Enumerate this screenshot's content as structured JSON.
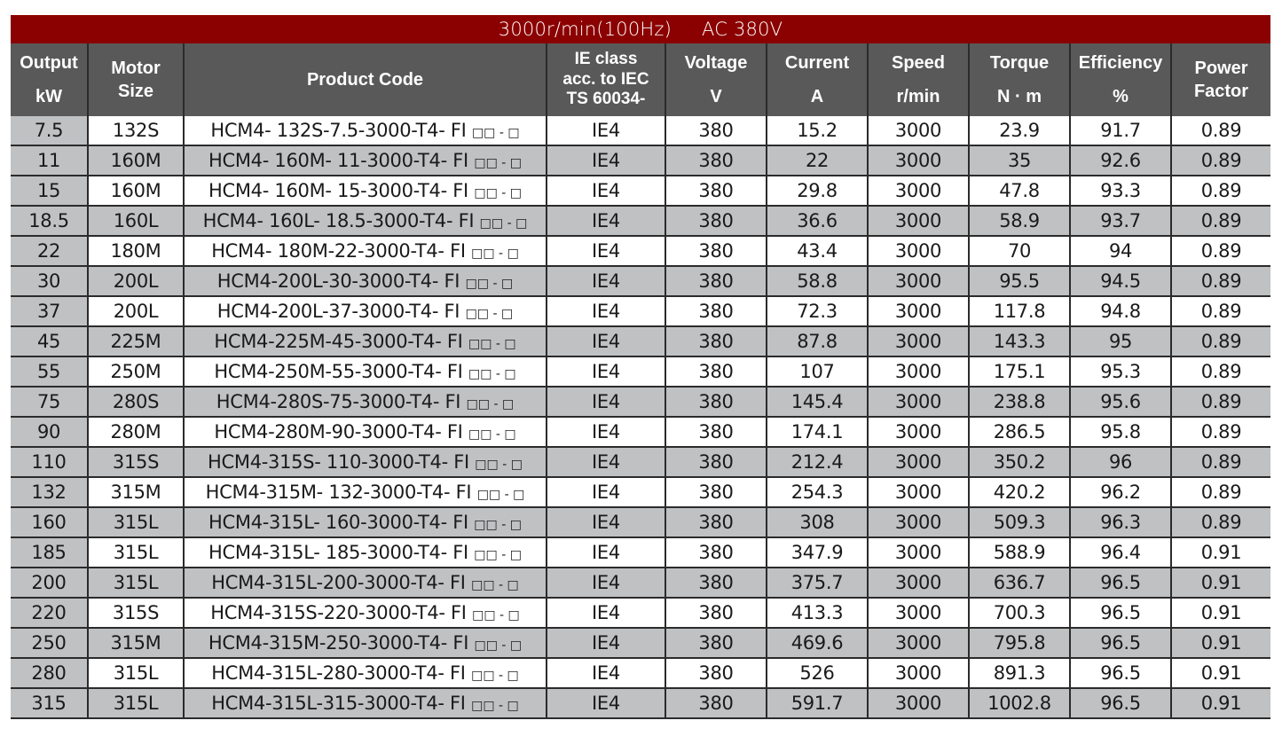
{
  "title": {
    "speed": "3000r/min(100Hz)",
    "voltage": "AC 380V"
  },
  "colors": {
    "title_bar": "#8b0000",
    "header_bg": "#595959",
    "stripe_grey": "#bfc1c3",
    "stripe_white": "#ffffff"
  },
  "headers": [
    {
      "line1": "Output",
      "line2": "kW"
    },
    {
      "line1": "Motor",
      "line2": "Size"
    },
    {
      "line1": "Product Code"
    },
    {
      "line1": "IE class",
      "line2": "acc. to IEC",
      "line3": "TS 60034-"
    },
    {
      "line1": "Voltage",
      "line2": "V"
    },
    {
      "line1": "Current",
      "line2": "A"
    },
    {
      "line1": "Speed",
      "line2": "r/min"
    },
    {
      "line1": "Torque",
      "line2": "N · m"
    },
    {
      "line1": "Efficiency",
      "line2": "%"
    },
    {
      "line1": "Power",
      "line2": "Factor"
    }
  ],
  "code_suffix": "□□ - □",
  "rows": [
    {
      "kw": "7.5",
      "size": "132S",
      "code": "HCM4- 132S-7.5-3000-T4- FI",
      "ie": "IE4",
      "v": "380",
      "a": "15.2",
      "rpm": "3000",
      "nm": "23.9",
      "eff": "91.7",
      "pf": "0.89"
    },
    {
      "kw": "11",
      "size": "160M",
      "code": "HCM4- 160M- 11-3000-T4- FI",
      "ie": "IE4",
      "v": "380",
      "a": "22",
      "rpm": "3000",
      "nm": "35",
      "eff": "92.6",
      "pf": "0.89"
    },
    {
      "kw": "15",
      "size": "160M",
      "code": "HCM4- 160M- 15-3000-T4- FI",
      "ie": "IE4",
      "v": "380",
      "a": "29.8",
      "rpm": "3000",
      "nm": "47.8",
      "eff": "93.3",
      "pf": "0.89"
    },
    {
      "kw": "18.5",
      "size": "160L",
      "code": "HCM4- 160L- 18.5-3000-T4- FI",
      "ie": "IE4",
      "v": "380",
      "a": "36.6",
      "rpm": "3000",
      "nm": "58.9",
      "eff": "93.7",
      "pf": "0.89"
    },
    {
      "kw": "22",
      "size": "180M",
      "code": "HCM4- 180M-22-3000-T4- FI",
      "ie": "IE4",
      "v": "380",
      "a": "43.4",
      "rpm": "3000",
      "nm": "70",
      "eff": "94",
      "pf": "0.89"
    },
    {
      "kw": "30",
      "size": "200L",
      "code": "HCM4-200L-30-3000-T4- FI",
      "ie": "IE4",
      "v": "380",
      "a": "58.8",
      "rpm": "3000",
      "nm": "95.5",
      "eff": "94.5",
      "pf": "0.89"
    },
    {
      "kw": "37",
      "size": "200L",
      "code": "HCM4-200L-37-3000-T4- FI",
      "ie": "IE4",
      "v": "380",
      "a": "72.3",
      "rpm": "3000",
      "nm": "117.8",
      "eff": "94.8",
      "pf": "0.89"
    },
    {
      "kw": "45",
      "size": "225M",
      "code": "HCM4-225M-45-3000-T4- FI",
      "ie": "IE4",
      "v": "380",
      "a": "87.8",
      "rpm": "3000",
      "nm": "143.3",
      "eff": "95",
      "pf": "0.89"
    },
    {
      "kw": "55",
      "size": "250M",
      "code": "HCM4-250M-55-3000-T4- FI",
      "ie": "IE4",
      "v": "380",
      "a": "107",
      "rpm": "3000",
      "nm": "175.1",
      "eff": "95.3",
      "pf": "0.89"
    },
    {
      "kw": "75",
      "size": "280S",
      "code": "HCM4-280S-75-3000-T4- FI",
      "ie": "IE4",
      "v": "380",
      "a": "145.4",
      "rpm": "3000",
      "nm": "238.8",
      "eff": "95.6",
      "pf": "0.89"
    },
    {
      "kw": "90",
      "size": "280M",
      "code": "HCM4-280M-90-3000-T4- FI",
      "ie": "IE4",
      "v": "380",
      "a": "174.1",
      "rpm": "3000",
      "nm": "286.5",
      "eff": "95.8",
      "pf": "0.89"
    },
    {
      "kw": "110",
      "size": "315S",
      "code": "HCM4-315S- 110-3000-T4- FI",
      "ie": "IE4",
      "v": "380",
      "a": "212.4",
      "rpm": "3000",
      "nm": "350.2",
      "eff": "96",
      "pf": "0.89"
    },
    {
      "kw": "132",
      "size": "315M",
      "code": "HCM4-315M- 132-3000-T4- FI",
      "ie": "IE4",
      "v": "380",
      "a": "254.3",
      "rpm": "3000",
      "nm": "420.2",
      "eff": "96.2",
      "pf": "0.89"
    },
    {
      "kw": "160",
      "size": "315L",
      "code": "HCM4-315L- 160-3000-T4- FI",
      "ie": "IE4",
      "v": "380",
      "a": "308",
      "rpm": "3000",
      "nm": "509.3",
      "eff": "96.3",
      "pf": "0.89"
    },
    {
      "kw": "185",
      "size": "315L",
      "code": "HCM4-315L- 185-3000-T4- FI",
      "ie": "IE4",
      "v": "380",
      "a": "347.9",
      "rpm": "3000",
      "nm": "588.9",
      "eff": "96.4",
      "pf": "0.91"
    },
    {
      "kw": "200",
      "size": "315L",
      "code": "HCM4-315L-200-3000-T4- FI",
      "ie": "IE4",
      "v": "380",
      "a": "375.7",
      "rpm": "3000",
      "nm": "636.7",
      "eff": "96.5",
      "pf": "0.91"
    },
    {
      "kw": "220",
      "size": "315S",
      "code": "HCM4-315S-220-3000-T4- FI",
      "ie": "IE4",
      "v": "380",
      "a": "413.3",
      "rpm": "3000",
      "nm": "700.3",
      "eff": "96.5",
      "pf": "0.91"
    },
    {
      "kw": "250",
      "size": "315M",
      "code": "HCM4-315M-250-3000-T4- FI",
      "ie": "IE4",
      "v": "380",
      "a": "469.6",
      "rpm": "3000",
      "nm": "795.8",
      "eff": "96.5",
      "pf": "0.91"
    },
    {
      "kw": "280",
      "size": "315L",
      "code": "HCM4-315L-280-3000-T4- FI",
      "ie": "IE4",
      "v": "380",
      "a": "526",
      "rpm": "3000",
      "nm": "891.3",
      "eff": "96.5",
      "pf": "0.91"
    },
    {
      "kw": "315",
      "size": "315L",
      "code": "HCM4-315L-315-3000-T4- FI",
      "ie": "IE4",
      "v": "380",
      "a": "591.7",
      "rpm": "3000",
      "nm": "1002.8",
      "eff": "96.5",
      "pf": "0.91"
    }
  ]
}
